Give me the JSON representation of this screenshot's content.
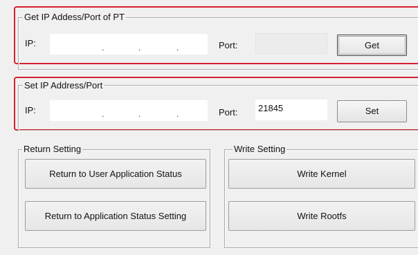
{
  "get_section": {
    "title": "Get IP Addess/Port of PT",
    "ip_label": "IP:",
    "ip_value": "",
    "port_label": "Port:",
    "port_value": "",
    "button_label": "Get"
  },
  "set_section": {
    "title": "Set IP Address/Port",
    "ip_label": "IP:",
    "ip_value": "",
    "port_label": "Port:",
    "port_value": "21845",
    "button_label": "Set"
  },
  "return_setting": {
    "title": "Return Setting",
    "buttons": [
      "Return to User Application Status",
      "Return to Application Status Setting"
    ]
  },
  "write_setting": {
    "title": "Write Setting",
    "buttons": [
      "Write Kernel",
      "Write Rootfs"
    ]
  },
  "colors": {
    "highlight": "#d6202f",
    "background": "#f0f0f0",
    "field": "#ffffff",
    "disabled_field": "#ececec"
  }
}
